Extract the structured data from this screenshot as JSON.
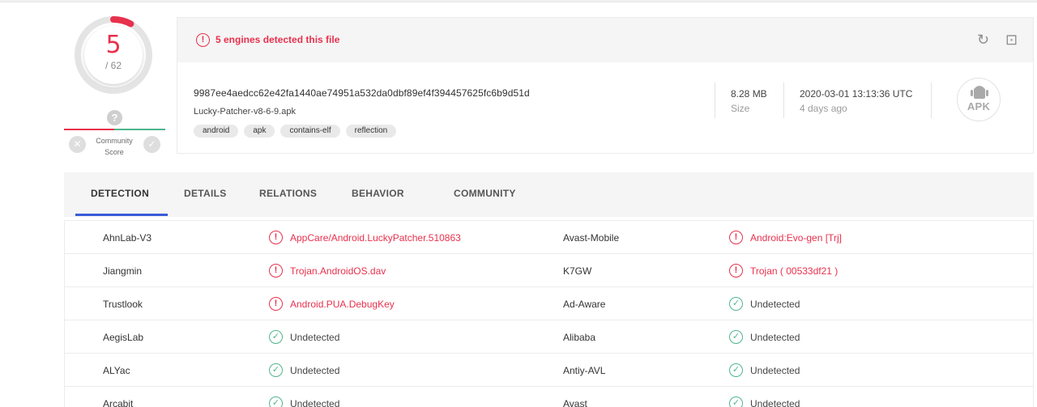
{
  "score": {
    "detected": "5",
    "total": "/ 62",
    "community_label": "Community Score",
    "question_glyph": "?",
    "vote_down_glyph": "✕",
    "vote_up_glyph": "✓",
    "ring_color": "#e8314d"
  },
  "header": {
    "alert_text": "5 engines detected this file",
    "alert_glyph": "!",
    "reanalyze_glyph": "↻",
    "similar_glyph": "⊡",
    "hash": "9987ee4aedcc62e42fa1440ae74951a532da0dbf89ef4f394457625fc6b9d51d",
    "filename": "Lucky-Patcher-v8-6-9.apk",
    "tags": [
      "android",
      "apk",
      "contains-elf",
      "reflection"
    ],
    "size_value": "8.28 MB",
    "size_label": "Size",
    "date_value": "2020-03-01 13:13:36 UTC",
    "date_label": "4 days ago",
    "filetype": "APK"
  },
  "tabs": [
    {
      "label": "DETECTION"
    },
    {
      "label": "DETAILS"
    },
    {
      "label": "RELATIONS"
    },
    {
      "label": "BEHAVIOR"
    },
    {
      "label": "COMMUNITY"
    }
  ],
  "detections": [
    {
      "left": {
        "engine": "AhnLab-V3",
        "result": "AppCare/Android.LuckyPatcher.510863",
        "status": "bad",
        "glyph": "!"
      },
      "right": {
        "engine": "Avast-Mobile",
        "result": "Android:Evo-gen [Trj]",
        "status": "bad",
        "glyph": "!"
      }
    },
    {
      "left": {
        "engine": "Jiangmin",
        "result": "Trojan.AndroidOS.dav",
        "status": "bad",
        "glyph": "!"
      },
      "right": {
        "engine": "K7GW",
        "result": "Trojan ( 00533df21 )",
        "status": "bad",
        "glyph": "!"
      }
    },
    {
      "left": {
        "engine": "Trustlook",
        "result": "Android.PUA.DebugKey",
        "status": "bad",
        "glyph": "!"
      },
      "right": {
        "engine": "Ad-Aware",
        "result": "Undetected",
        "status": "ok",
        "glyph": "✓"
      }
    },
    {
      "left": {
        "engine": "AegisLab",
        "result": "Undetected",
        "status": "ok",
        "glyph": "✓"
      },
      "right": {
        "engine": "Alibaba",
        "result": "Undetected",
        "status": "ok",
        "glyph": "✓"
      }
    },
    {
      "left": {
        "engine": "ALYac",
        "result": "Undetected",
        "status": "ok",
        "glyph": "✓"
      },
      "right": {
        "engine": "Antiy-AVL",
        "result": "Undetected",
        "status": "ok",
        "glyph": "✓"
      }
    },
    {
      "left": {
        "engine": "Arcabit",
        "result": "Undetected",
        "status": "ok",
        "glyph": "✓"
      },
      "right": {
        "engine": "Avast",
        "result": "Undetected",
        "status": "ok",
        "glyph": "✓"
      }
    }
  ],
  "colors": {
    "danger": "#e8314d",
    "success": "#4fb58c",
    "accent": "#3a5bd9"
  }
}
